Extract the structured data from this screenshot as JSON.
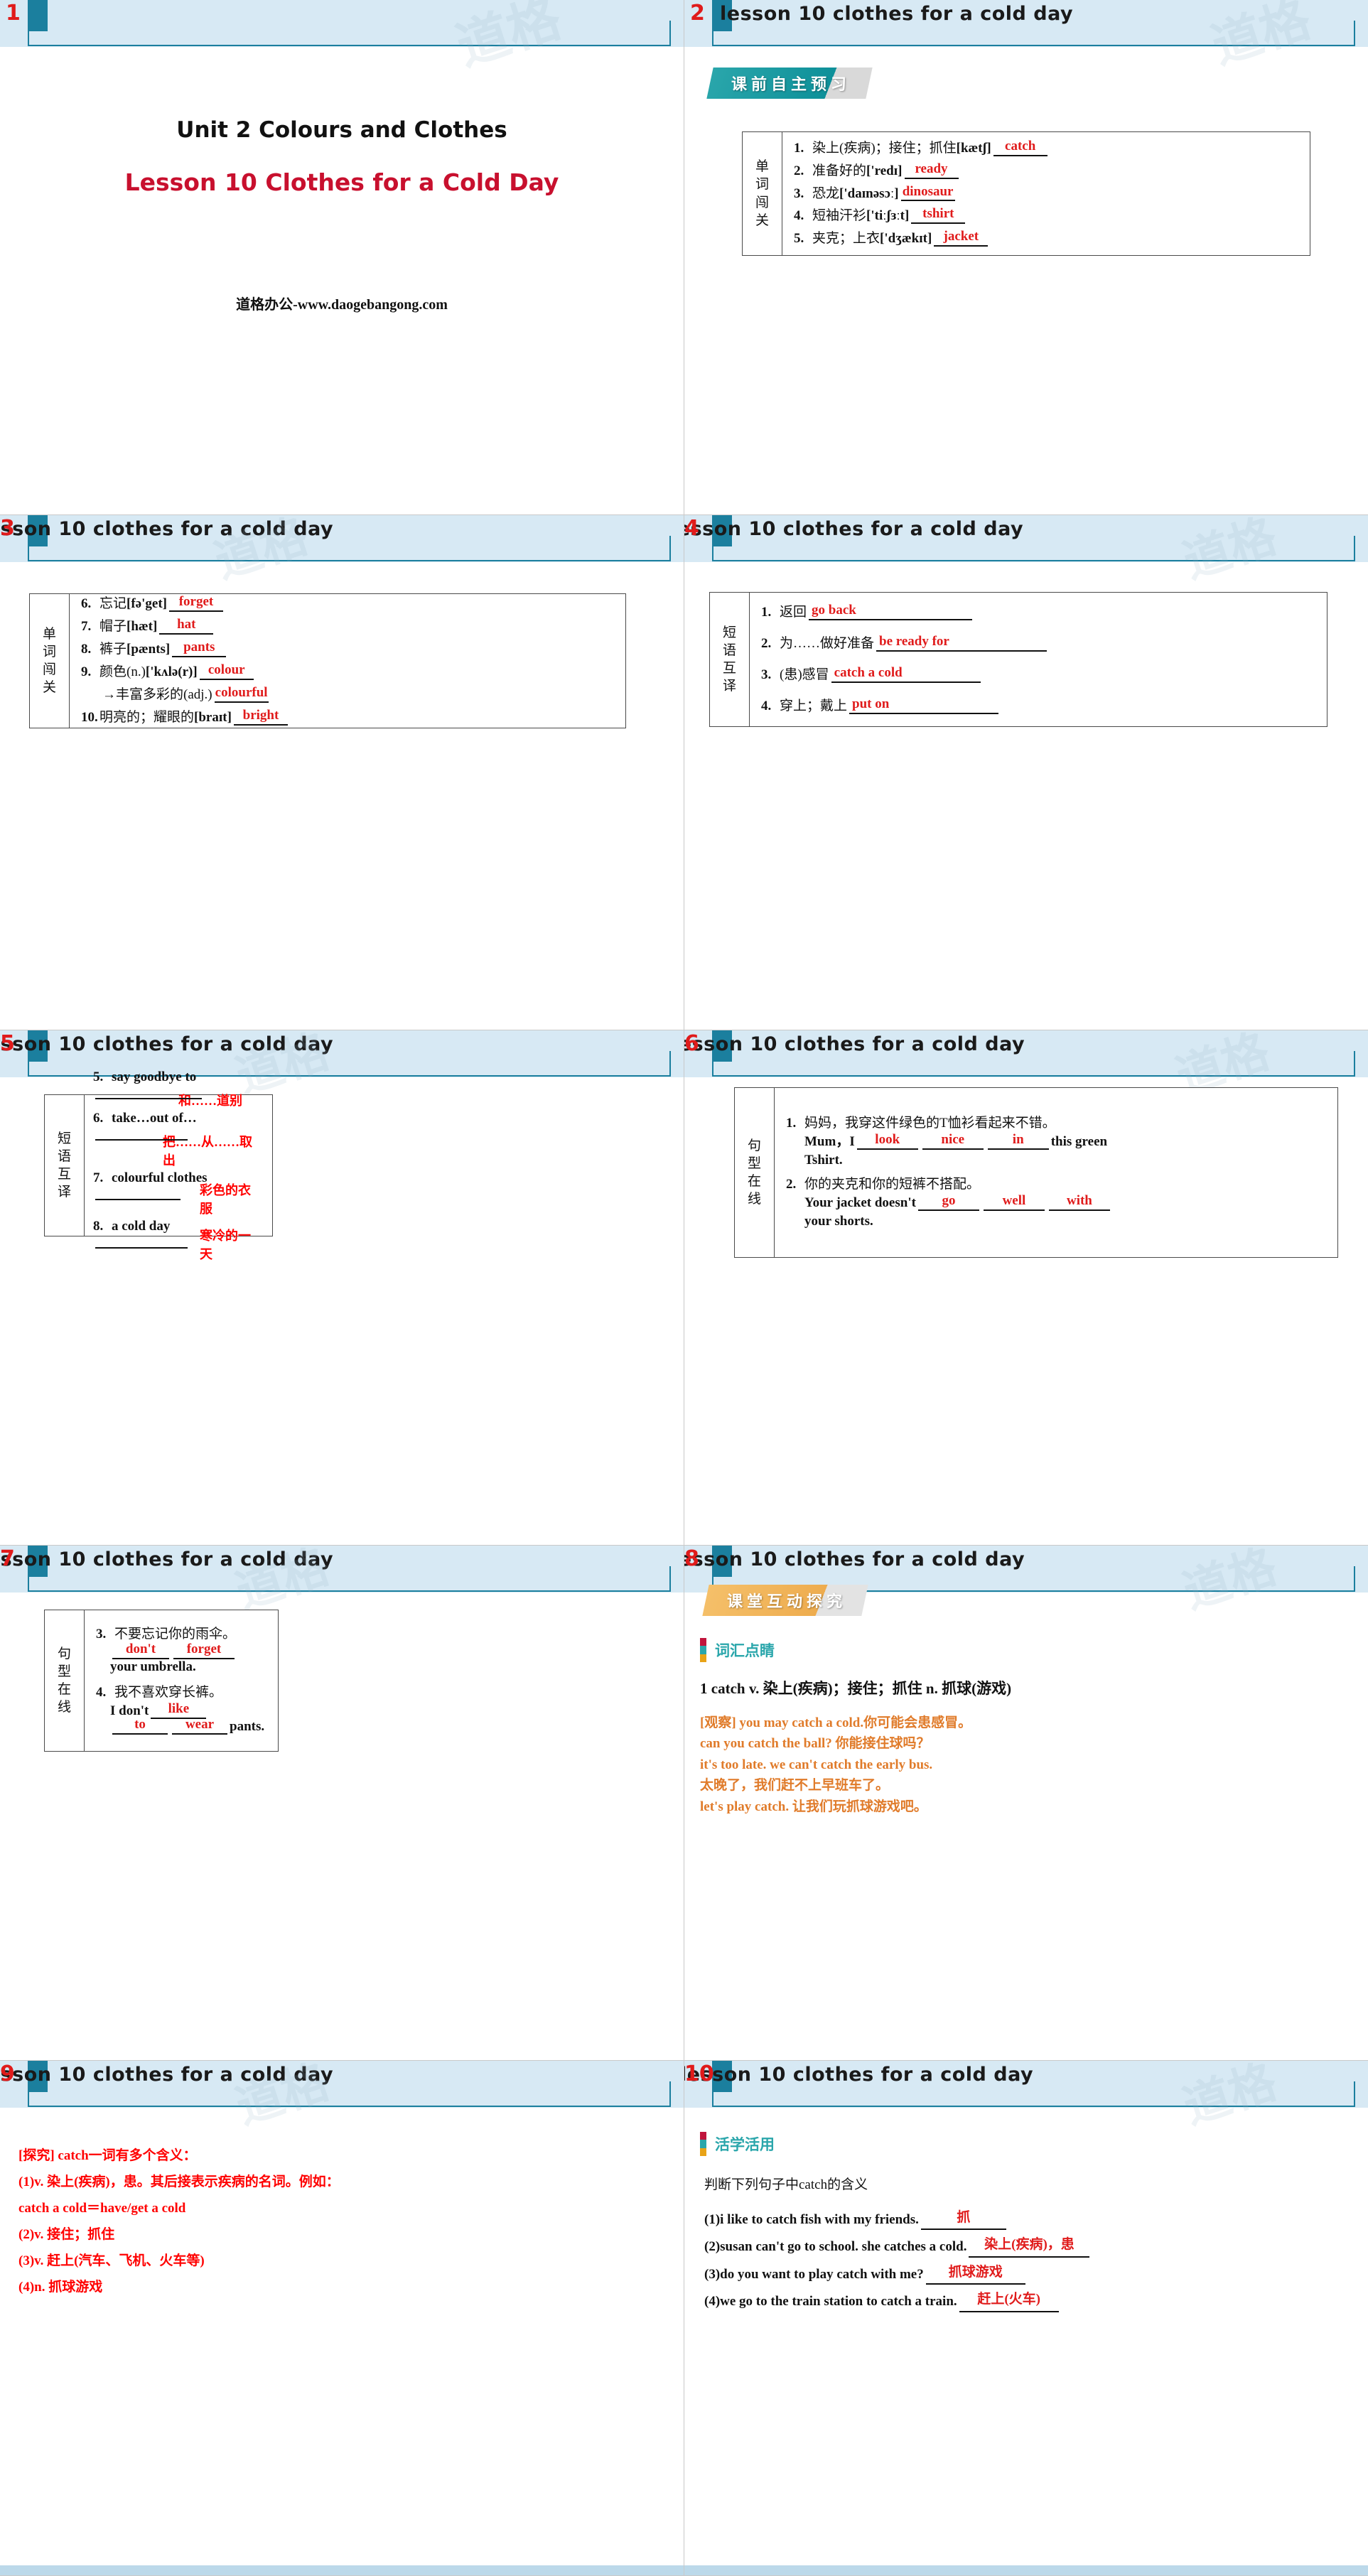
{
  "deck": {
    "header_title": "lesson 10   clothes for a cold day",
    "watermark": "道格"
  },
  "slide1": {
    "number": "1",
    "unit_title": "Unit 2  Colours and Clothes",
    "lesson_title": "Lesson 10  Clothes for a Cold Day",
    "footer": "道格办公-www.daogebangong.com"
  },
  "slide2": {
    "number": "2",
    "banner": "课前自主预习",
    "table_label": "单词闯关",
    "rows": [
      {
        "num": "1.",
        "cn": "染上(疾病)；接住；抓住",
        "ipa": "[kætʃ]",
        "answer": "catch"
      },
      {
        "num": "2.",
        "cn": "准备好的",
        "ipa": "['redɪ]",
        "answer": "ready"
      },
      {
        "num": "3.",
        "cn": "恐龙",
        "ipa": "['daɪnəsɔː]",
        "answer": "dinosaur"
      },
      {
        "num": "4.",
        "cn": "短袖汗衫",
        "ipa": "['tiːʃɜːt]",
        "answer": "tshirt"
      },
      {
        "num": "5.",
        "cn": "夹克；上衣",
        "ipa": "['dʒækɪt]",
        "answer": "jacket"
      }
    ]
  },
  "slide3": {
    "number": "3",
    "table_label": "单词闯关",
    "rows": [
      {
        "num": "6.",
        "cn": "忘记",
        "ipa": "[fə'get]",
        "answer": "forget"
      },
      {
        "num": "7.",
        "cn": "帽子",
        "ipa": "[hæt]",
        "answer": "hat"
      },
      {
        "num": "8.",
        "cn": "裤子",
        "ipa": "[pænts]",
        "answer": "pants"
      },
      {
        "num": "9.",
        "cn": "颜色(n.)",
        "ipa": "['kʌlə(r)]",
        "answer": "colour"
      },
      {
        "num": "",
        "cn": "→丰富多彩的(adj.)",
        "ipa": "",
        "answer": "colourful"
      },
      {
        "num": "10.",
        "cn": "明亮的；耀眼的",
        "ipa": "[braɪt]",
        "answer": "bright"
      }
    ]
  },
  "slide4": {
    "number": "4",
    "table_label": "短语互译",
    "rows": [
      {
        "num": "1.",
        "cn": "返回",
        "answer": "go back"
      },
      {
        "num": "2.",
        "cn": "为……做好准备",
        "answer": "be ready for"
      },
      {
        "num": "3.",
        "cn": "(患)感冒",
        "answer": "catch a cold"
      },
      {
        "num": "4.",
        "cn": "穿上；戴上",
        "answer": "put on"
      }
    ]
  },
  "slide5": {
    "number": "5",
    "table_label": "短语互译",
    "rows": [
      {
        "num": "5.",
        "en": "say goodbye to",
        "answer": "和……道别"
      },
      {
        "num": "6.",
        "en": "take…out of…",
        "answer": "把……从……取出"
      },
      {
        "num": "7.",
        "en": "colourful clothes",
        "answer": "彩色的衣服"
      },
      {
        "num": "8.",
        "en": "a cold day",
        "answer": "寒冷的一天"
      }
    ]
  },
  "slide6": {
    "number": "6",
    "table_label": "句型在线",
    "q1": {
      "num": "1.",
      "cn": "妈妈，我穿这件绿色的T恤衫看起来不错。",
      "pre": "Mum，I",
      "blanks": [
        "look",
        "nice",
        "in"
      ],
      "tail": "this green",
      "line2": "Tshirt."
    },
    "q2": {
      "num": "2.",
      "cn": "你的夹克和你的短裤不搭配。",
      "pre": "Your jacket doesn't",
      "blanks": [
        "go",
        "well",
        "with"
      ],
      "line2": "your shorts."
    }
  },
  "slide7": {
    "number": "7",
    "table_label": "句型在线",
    "q3": {
      "num": "3.",
      "cn": "不要忘记你的雨伞。",
      "blanks": [
        "don't",
        "forget"
      ],
      "tail": "your umbrella."
    },
    "q4": {
      "num": "4.",
      "cn": "我不喜欢穿长裤。",
      "pre": "I don't",
      "blanks": [
        "like",
        "to",
        "wear"
      ],
      "tail": "pants."
    }
  },
  "slide8": {
    "number": "8",
    "banner": "课堂互动探究",
    "section": "词汇点睛",
    "entry": "1    catch v. 染上(疾病)；接住；抓住   n. 抓球(游戏)",
    "examples": [
      "[观察] you may catch a cold.你可能会患感冒。",
      "can you catch the ball? 你能接住球吗？",
      "it's too late. we can't catch the early bus.",
      "太晚了，我们赶不上早班车了。",
      "let's play catch. 让我们玩抓球游戏吧。"
    ]
  },
  "slide9": {
    "number": "9",
    "lines": [
      "[探究] catch一词有多个含义：",
      "(1)v. 染上(疾病)，患。其后接表示疾病的名词。例如：",
      "catch a cold＝have/get a cold",
      "(2)v. 接住；抓住",
      "(3)v. 赶上(汽车、飞机、火车等)",
      "(4)n. 抓球游戏"
    ]
  },
  "slide10": {
    "number": "10",
    "section": "活学活用",
    "prompt": "判断下列句子中catch的含义",
    "items": [
      {
        "q": "(1)i like to catch fish with my friends.",
        "answer": "抓"
      },
      {
        "q": "(2)susan can't go to school. she catches a cold.",
        "answer": "染上(疾病)，患"
      },
      {
        "q": "(3)do you want to play catch with me?",
        "answer": "抓球游戏"
      },
      {
        "q": "(4)we go to the train station to catch a train.",
        "answer": "赶上(火车)"
      }
    ]
  },
  "colors": {
    "header_band": "#d7e9f4",
    "accent_teal": "#1b7f9e",
    "answer_red": "#e01b1b",
    "orange": "#e07b2a"
  }
}
